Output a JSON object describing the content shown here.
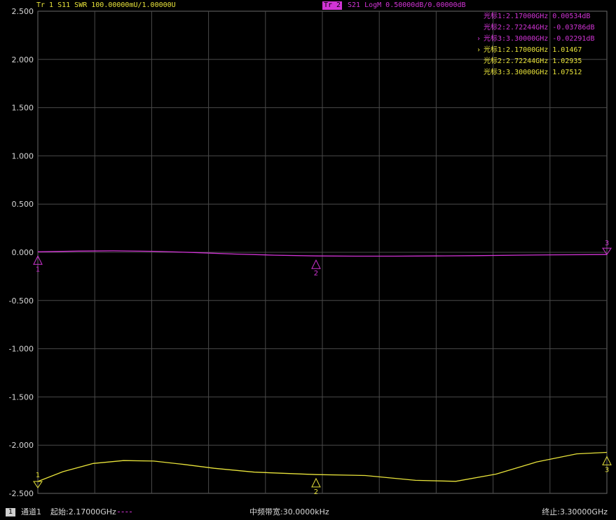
{
  "header": {
    "trace1_text": "Tr 1  S11 SWR 100.00000mU/1.00000U",
    "trace2_tag": "Tr 2",
    "trace2_text": "S21 LogM 0.50000dB/0.00000dB"
  },
  "colors": {
    "trace_s21": "#d234d6",
    "trace_s11": "#e8e33a",
    "grid": "#4a4a4a",
    "axis_text": "#d8d8d8"
  },
  "marker_readout": {
    "s21": [
      {
        "arrow": "",
        "text": "光标1:2.17000GHz 0.00534dB"
      },
      {
        "arrow": "",
        "text": "光标2:2.72244GHz -0.03786dB"
      },
      {
        "arrow": "›",
        "text": "光标3:3.30000GHz -0.02291dB"
      }
    ],
    "s11": [
      {
        "arrow": "›",
        "text": "光标1:2.17000GHz 1.01467"
      },
      {
        "arrow": "",
        "text": "光标2:2.72244GHz 1.02935"
      },
      {
        "arrow": "",
        "text": "光标3:3.30000GHz 1.07512"
      }
    ]
  },
  "footer": {
    "channel_number": "1",
    "channel_label": "通道1",
    "start_label": "起始:2.17000GHz",
    "if_bw_label": "中频带宽:30.0000kHz",
    "stop_label": "终止:3.30000GHz"
  },
  "chart_data": {
    "type": "line",
    "y_tick_labels": [
      "2.500",
      "2.000",
      "1.500",
      "1.000",
      "0.500",
      "0.000",
      "-0.500",
      "-1.000",
      "-1.500",
      "-2.000",
      "-2.500"
    ],
    "ylim": [
      -2.5,
      2.5
    ],
    "xlim": [
      2.17,
      3.3
    ],
    "grid": true,
    "series": [
      {
        "name": "S21 LogM",
        "key": "s21",
        "x": [
          2.17,
          2.25,
          2.32,
          2.4,
          2.48,
          2.56,
          2.64,
          2.72244,
          2.8,
          2.88,
          2.96,
          3.04,
          3.12,
          3.2,
          3.3
        ],
        "y": [
          0.005,
          0.012,
          0.015,
          0.01,
          -0.002,
          -0.018,
          -0.03,
          -0.038,
          -0.04,
          -0.04,
          -0.038,
          -0.035,
          -0.03,
          -0.026,
          -0.023
        ],
        "markers": [
          {
            "label": "1",
            "x": 2.17,
            "y": 0.00534
          },
          {
            "label": "2",
            "x": 2.72244,
            "y": -0.03786
          },
          {
            "label": "3",
            "x": 3.3,
            "y": -0.02291
          }
        ]
      },
      {
        "name": "S11 SWR",
        "key": "s11",
        "x": [
          2.17,
          2.22,
          2.28,
          2.34,
          2.4,
          2.46,
          2.52,
          2.6,
          2.72244,
          2.82,
          2.92,
          3.0,
          3.08,
          3.16,
          3.24,
          3.3
        ],
        "y": [
          1.0147,
          1.035,
          1.052,
          1.058,
          1.057,
          1.05,
          1.042,
          1.034,
          1.029,
          1.027,
          1.017,
          1.015,
          1.03,
          1.055,
          1.072,
          1.0751
        ],
        "markers": [
          {
            "label": "1",
            "x": 2.17,
            "y": 1.01467
          },
          {
            "label": "2",
            "x": 2.72244,
            "y": 1.02935
          },
          {
            "label": "3",
            "x": 3.3,
            "y": 1.07512
          }
        ]
      }
    ]
  }
}
